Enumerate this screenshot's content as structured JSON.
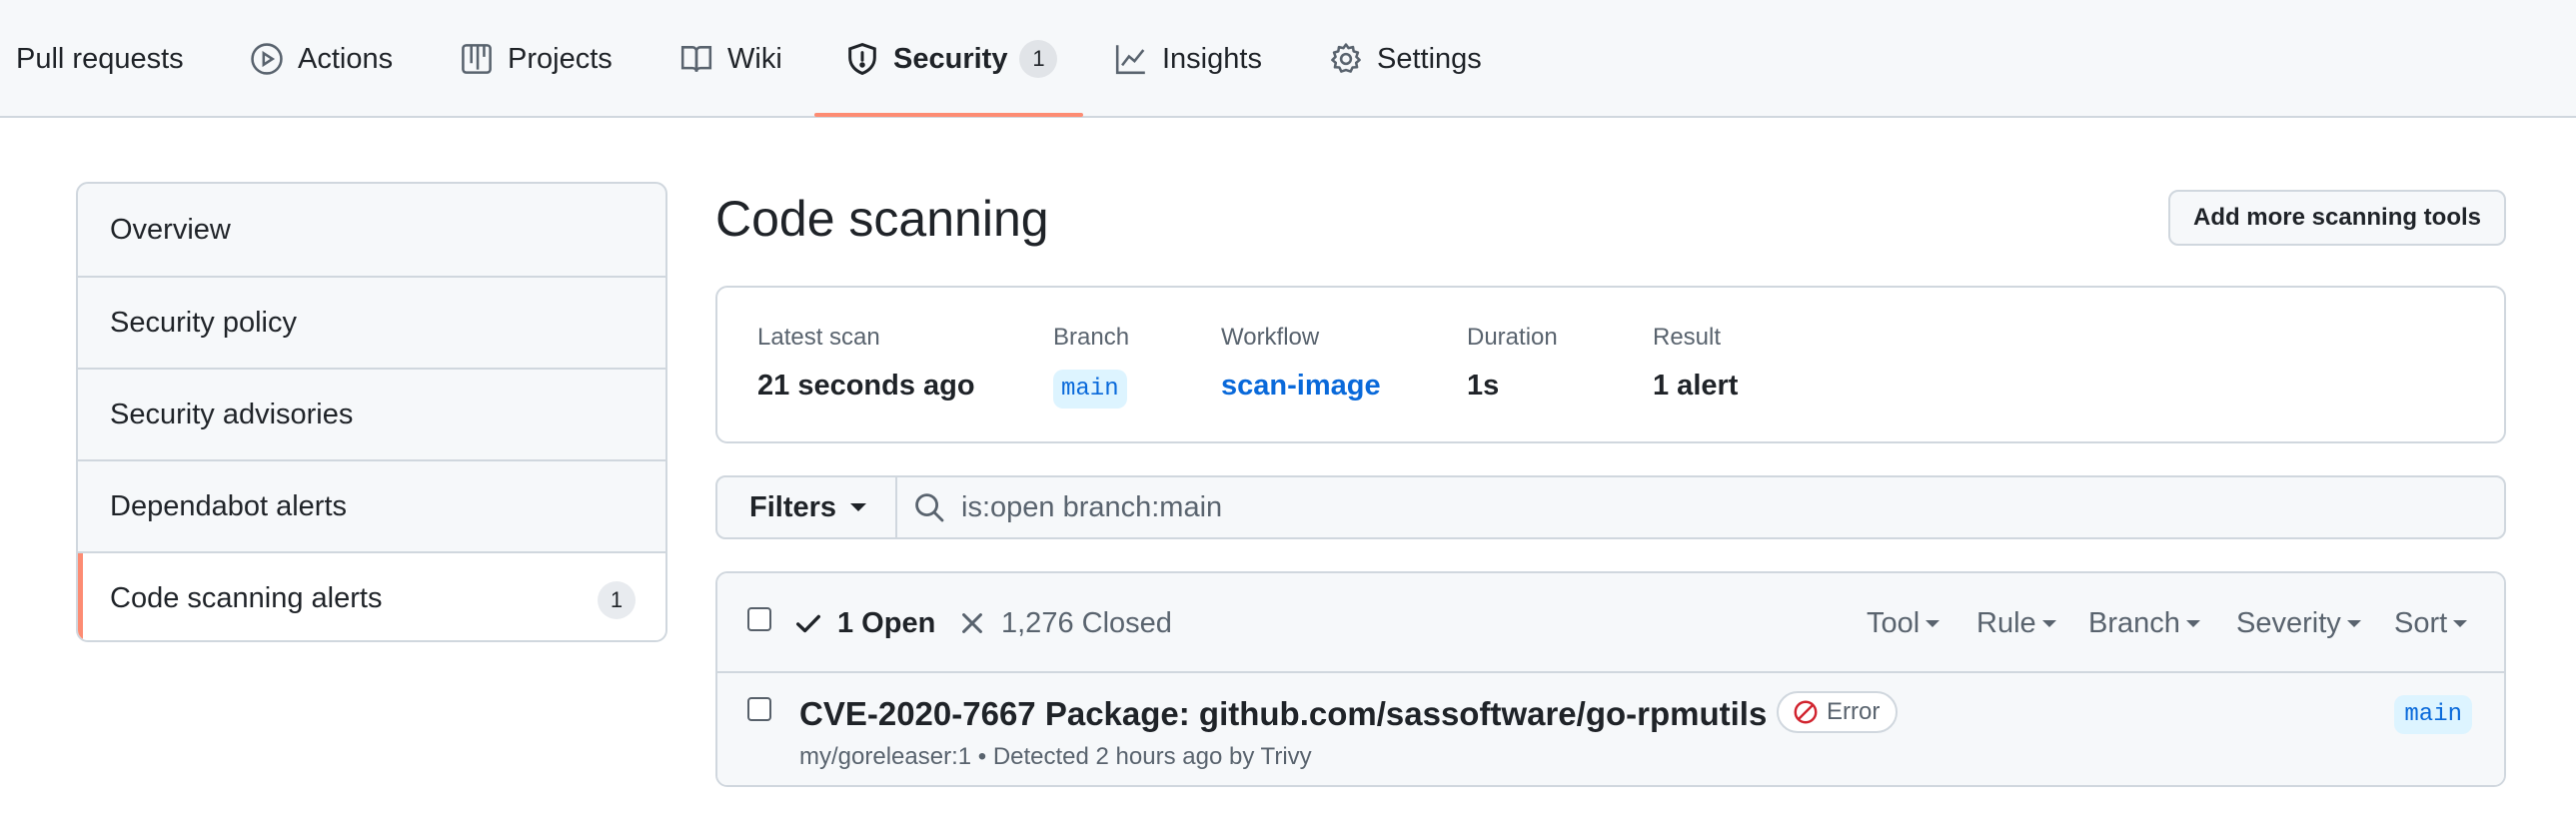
{
  "repo_nav": {
    "items": [
      {
        "label": "Pull requests",
        "icon": "git-pull-request-icon"
      },
      {
        "label": "Actions",
        "icon": "play-icon"
      },
      {
        "label": "Projects",
        "icon": "table-icon"
      },
      {
        "label": "Wiki",
        "icon": "book-icon"
      },
      {
        "label": "Security",
        "icon": "shield-icon",
        "counter": "1",
        "selected": true
      },
      {
        "label": "Insights",
        "icon": "graph-icon"
      },
      {
        "label": "Settings",
        "icon": "gear-icon"
      }
    ],
    "accent_color": "#fd8c73"
  },
  "sidebar": {
    "items": [
      {
        "label": "Overview"
      },
      {
        "label": "Security policy"
      },
      {
        "label": "Security advisories"
      },
      {
        "label": "Dependabot alerts"
      },
      {
        "label": "Code scanning alerts",
        "counter": "1",
        "active": true
      }
    ]
  },
  "main": {
    "title": "Code scanning",
    "add_tools_label": "Add more scanning tools",
    "scan": {
      "latest_scan_label": "Latest scan",
      "latest_scan_value": "21 seconds ago",
      "branch_label": "Branch",
      "branch_value": "main",
      "workflow_label": "Workflow",
      "workflow_value": "scan-image",
      "duration_label": "Duration",
      "duration_value": "1s",
      "result_label": "Result",
      "result_value": "1 alert"
    },
    "filters": {
      "button_label": "Filters",
      "query": "is:open branch:main"
    },
    "alerts": {
      "open_label": "1 Open",
      "closed_label": "1,276 Closed",
      "sort_menus": [
        "Tool",
        "Rule",
        "Branch",
        "Severity",
        "Sort"
      ],
      "rows": [
        {
          "title": "CVE-2020-7667 Package: github.com/sassoftware/go-rpmutils",
          "severity": "Error",
          "meta": "my/goreleaser:1 • Detected 2 hours ago by Trivy",
          "branch": "main"
        }
      ]
    }
  },
  "colors": {
    "link": "#0969da",
    "error_icon": "#d1242f",
    "border": "#d0d7de"
  }
}
